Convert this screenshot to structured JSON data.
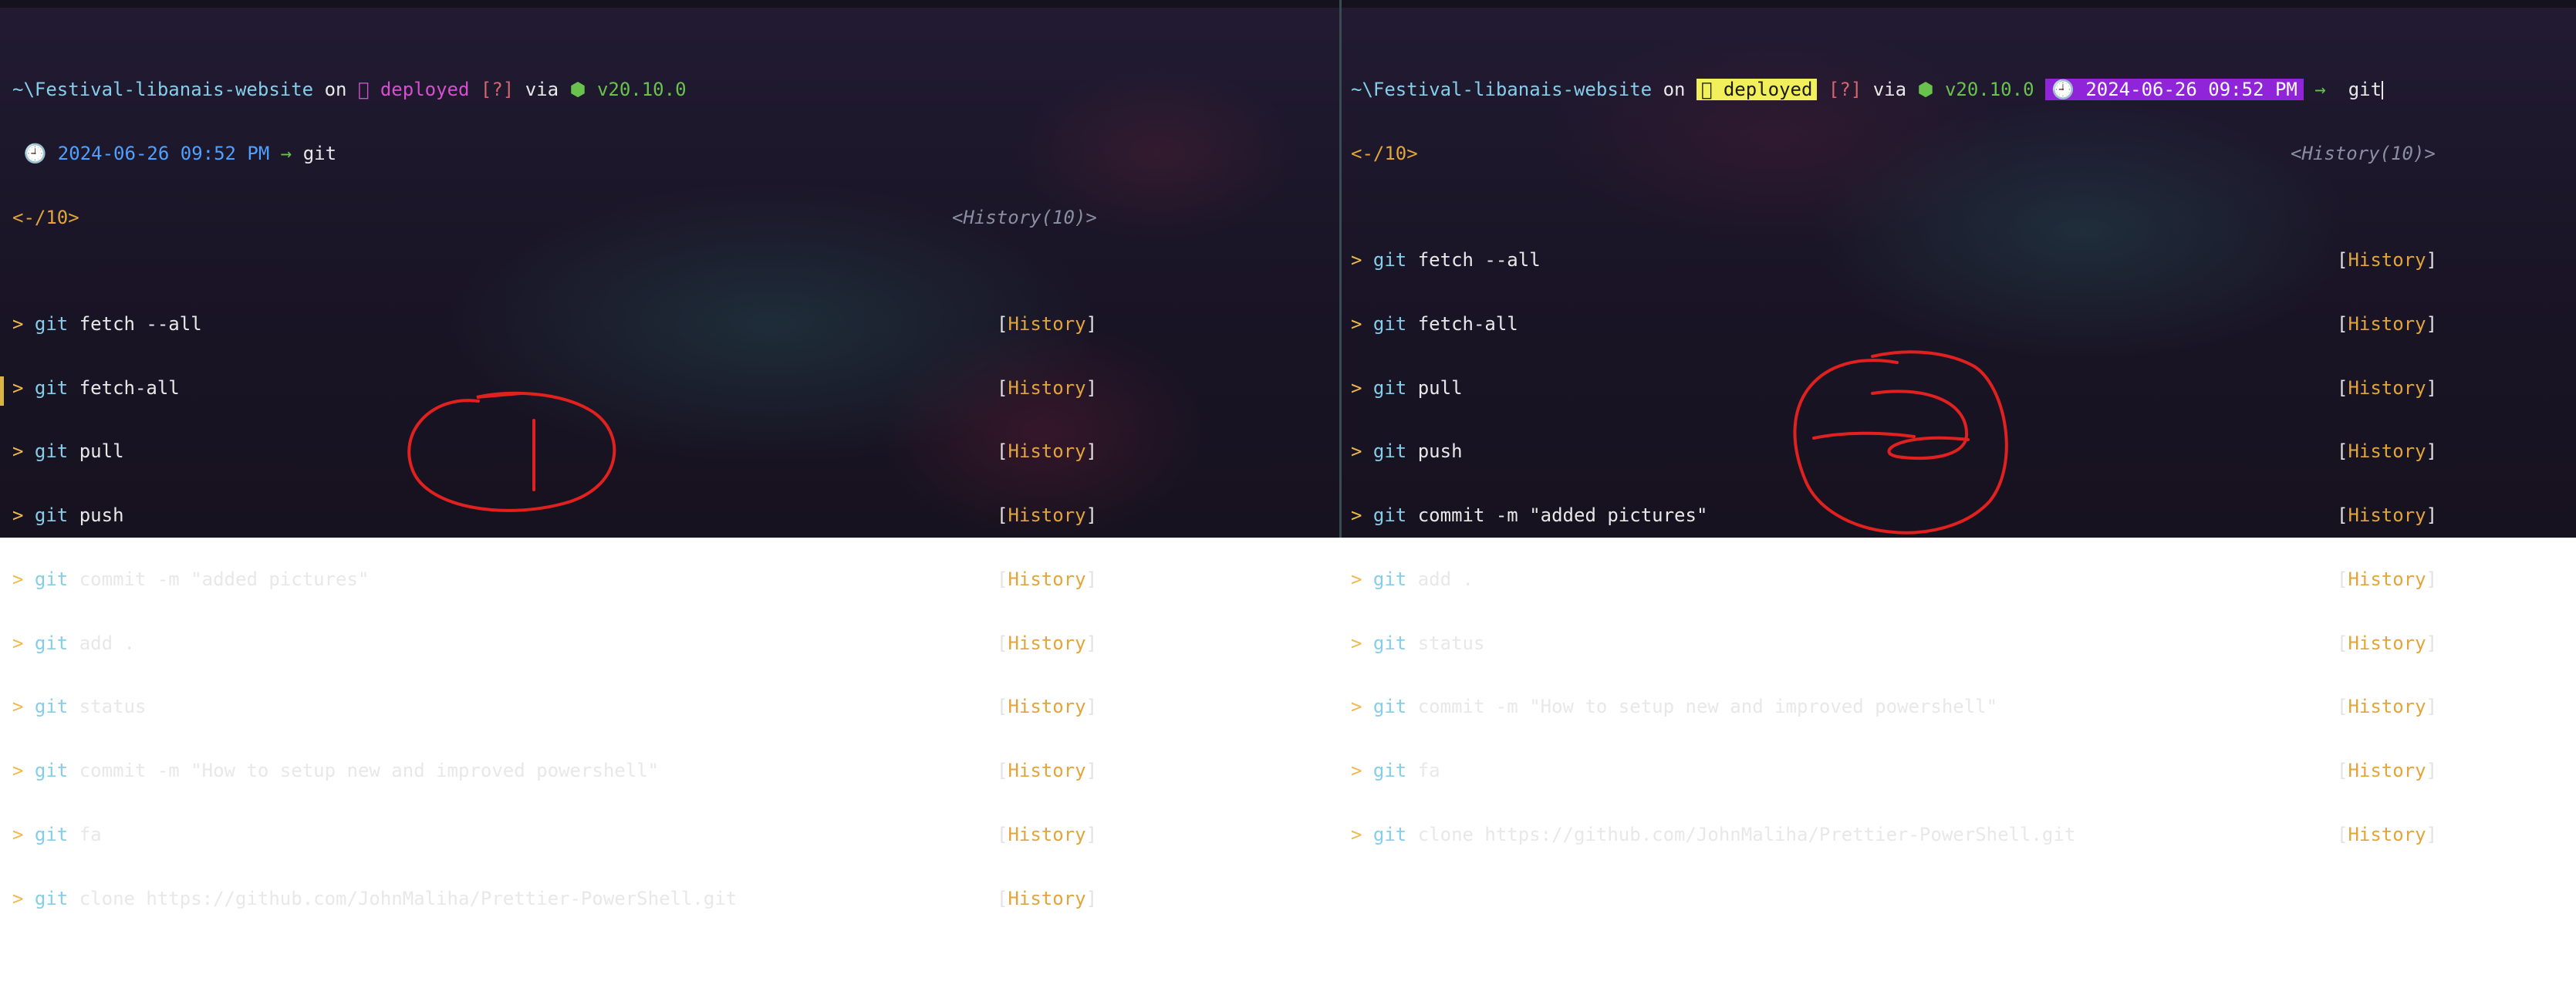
{
  "colors": {
    "background": "#1c1628",
    "path": "#86cdea",
    "branch_left": "#d54fcf",
    "status": "#d46670",
    "node": "#69c24d",
    "time": "#4fa0ff",
    "branch_badge_bg": "#f1f05a",
    "time_badge_bg": "#8f24d9",
    "history_label": "#e2a53b",
    "annotation": "#e0211f"
  },
  "left_pane": {
    "prompt": {
      "path": "~\\Festival-libanais-website",
      "on": "on",
      "branch_icon": "",
      "branch": "deployed",
      "status": "[?]",
      "via": "via",
      "node_icon": "⬢",
      "node_version": "v20.10.0",
      "clock_icon": "🕘",
      "datetime": "2024-06-26 09:52 PM",
      "arrow": "→",
      "input": "git"
    },
    "counter_left": "<-/10>",
    "counter_right": "<History(10)>",
    "history": [
      {
        "first": "git",
        "rest": " fetch --all",
        "tag": "History"
      },
      {
        "first": "git",
        "rest": " fetch-all",
        "tag": "History"
      },
      {
        "first": "git",
        "rest": " pull",
        "tag": "History"
      },
      {
        "first": "git",
        "rest": " push",
        "tag": "History"
      },
      {
        "first": "git",
        "rest": " commit -m \"added pictures\"",
        "tag": "History"
      },
      {
        "first": "git",
        "rest": " add .",
        "tag": "History"
      },
      {
        "first": "git",
        "rest": " status",
        "tag": "History"
      },
      {
        "first": "git",
        "rest": " commit -m \"How to setup new and improved powershell\"",
        "tag": "History"
      },
      {
        "first": "git",
        "rest": " fa",
        "tag": "History"
      },
      {
        "first": "git",
        "rest": " clone https://github.com/JohnMaliha/Prettier-PowerShell.git",
        "tag": "History"
      }
    ],
    "annotation": "1"
  },
  "right_pane": {
    "prompt": {
      "path": "~\\Festival-libanais-website",
      "on": "on",
      "branch_icon": "",
      "branch": "deployed",
      "status": "[?]",
      "via": "via",
      "node_icon": "⬢",
      "node_version": "v20.10.0",
      "clock_icon": "🕘",
      "datetime": "2024-06-26 09:52 PM",
      "arrow": "→",
      "input": "git"
    },
    "counter_left": "<-/10>",
    "counter_right": "<History(10)>",
    "history": [
      {
        "first": "git",
        "rest": " fetch --all",
        "tag": "History"
      },
      {
        "first": "git",
        "rest": " fetch-all",
        "tag": "History"
      },
      {
        "first": "git",
        "rest": " pull",
        "tag": "History"
      },
      {
        "first": "git",
        "rest": " push",
        "tag": "History"
      },
      {
        "first": "git",
        "rest": " commit -m \"added pictures\"",
        "tag": "History"
      },
      {
        "first": "git",
        "rest": " add .",
        "tag": "History"
      },
      {
        "first": "git",
        "rest": " status",
        "tag": "History"
      },
      {
        "first": "git",
        "rest": " commit -m \"How to setup new and improved powershell\"",
        "tag": "History"
      },
      {
        "first": "git",
        "rest": " fa",
        "tag": "History"
      },
      {
        "first": "git",
        "rest": " clone https://github.com/JohnMaliha/Prettier-PowerShell.git",
        "tag": "History"
      }
    ],
    "annotation": "2"
  },
  "history_prefix": ">"
}
